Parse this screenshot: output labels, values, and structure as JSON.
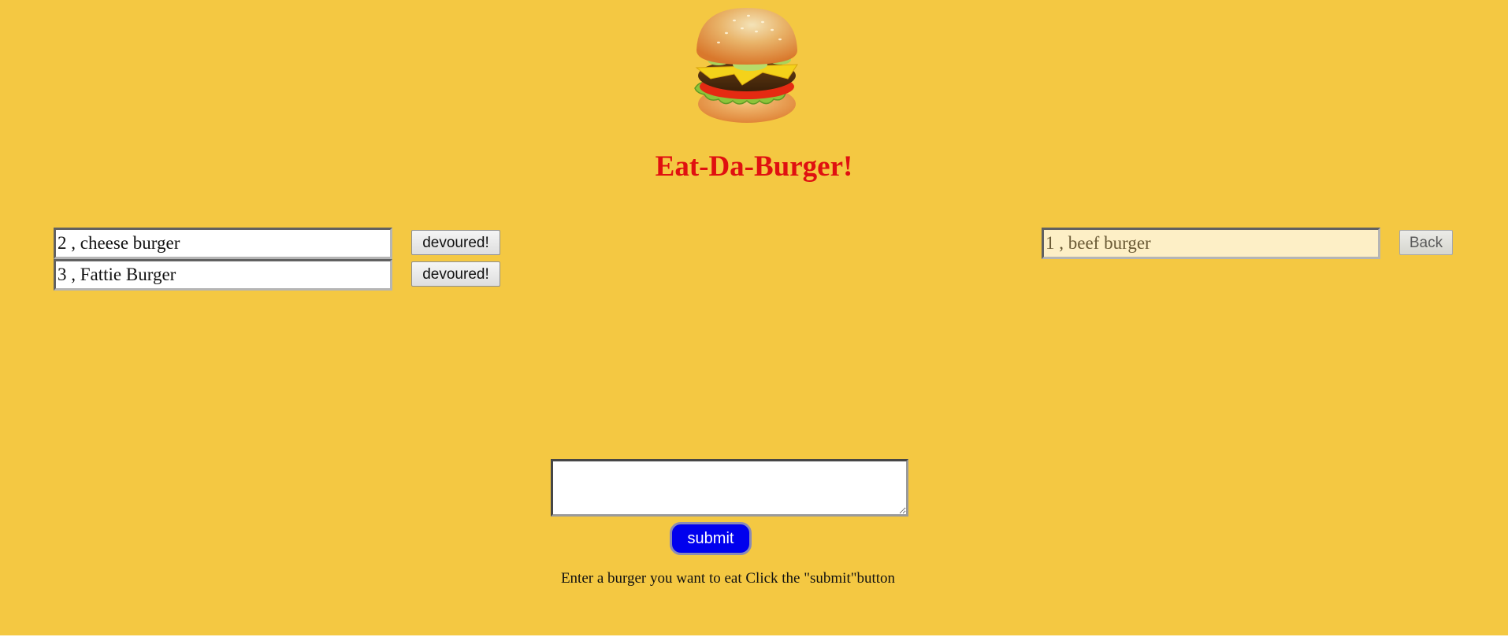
{
  "header": {
    "title": "Eat-Da-Burger!",
    "logo_icon": "hamburger-icon"
  },
  "not_devoured": [
    {
      "text": "2 , cheese burger",
      "button_label": "devoured!"
    },
    {
      "text": "3 , Fattie Burger",
      "button_label": "devoured!"
    }
  ],
  "devoured": [
    {
      "text": "1 , beef burger",
      "button_label": "Back"
    }
  ],
  "form": {
    "input_value": "",
    "submit_label": "submit",
    "instructions": "Enter a burger you want to eat Click the \"submit\"button"
  },
  "colors": {
    "background": "#f4c842",
    "title": "#e01010",
    "submit_button": "#0000ee",
    "devoured_field": "#fdefc6"
  }
}
